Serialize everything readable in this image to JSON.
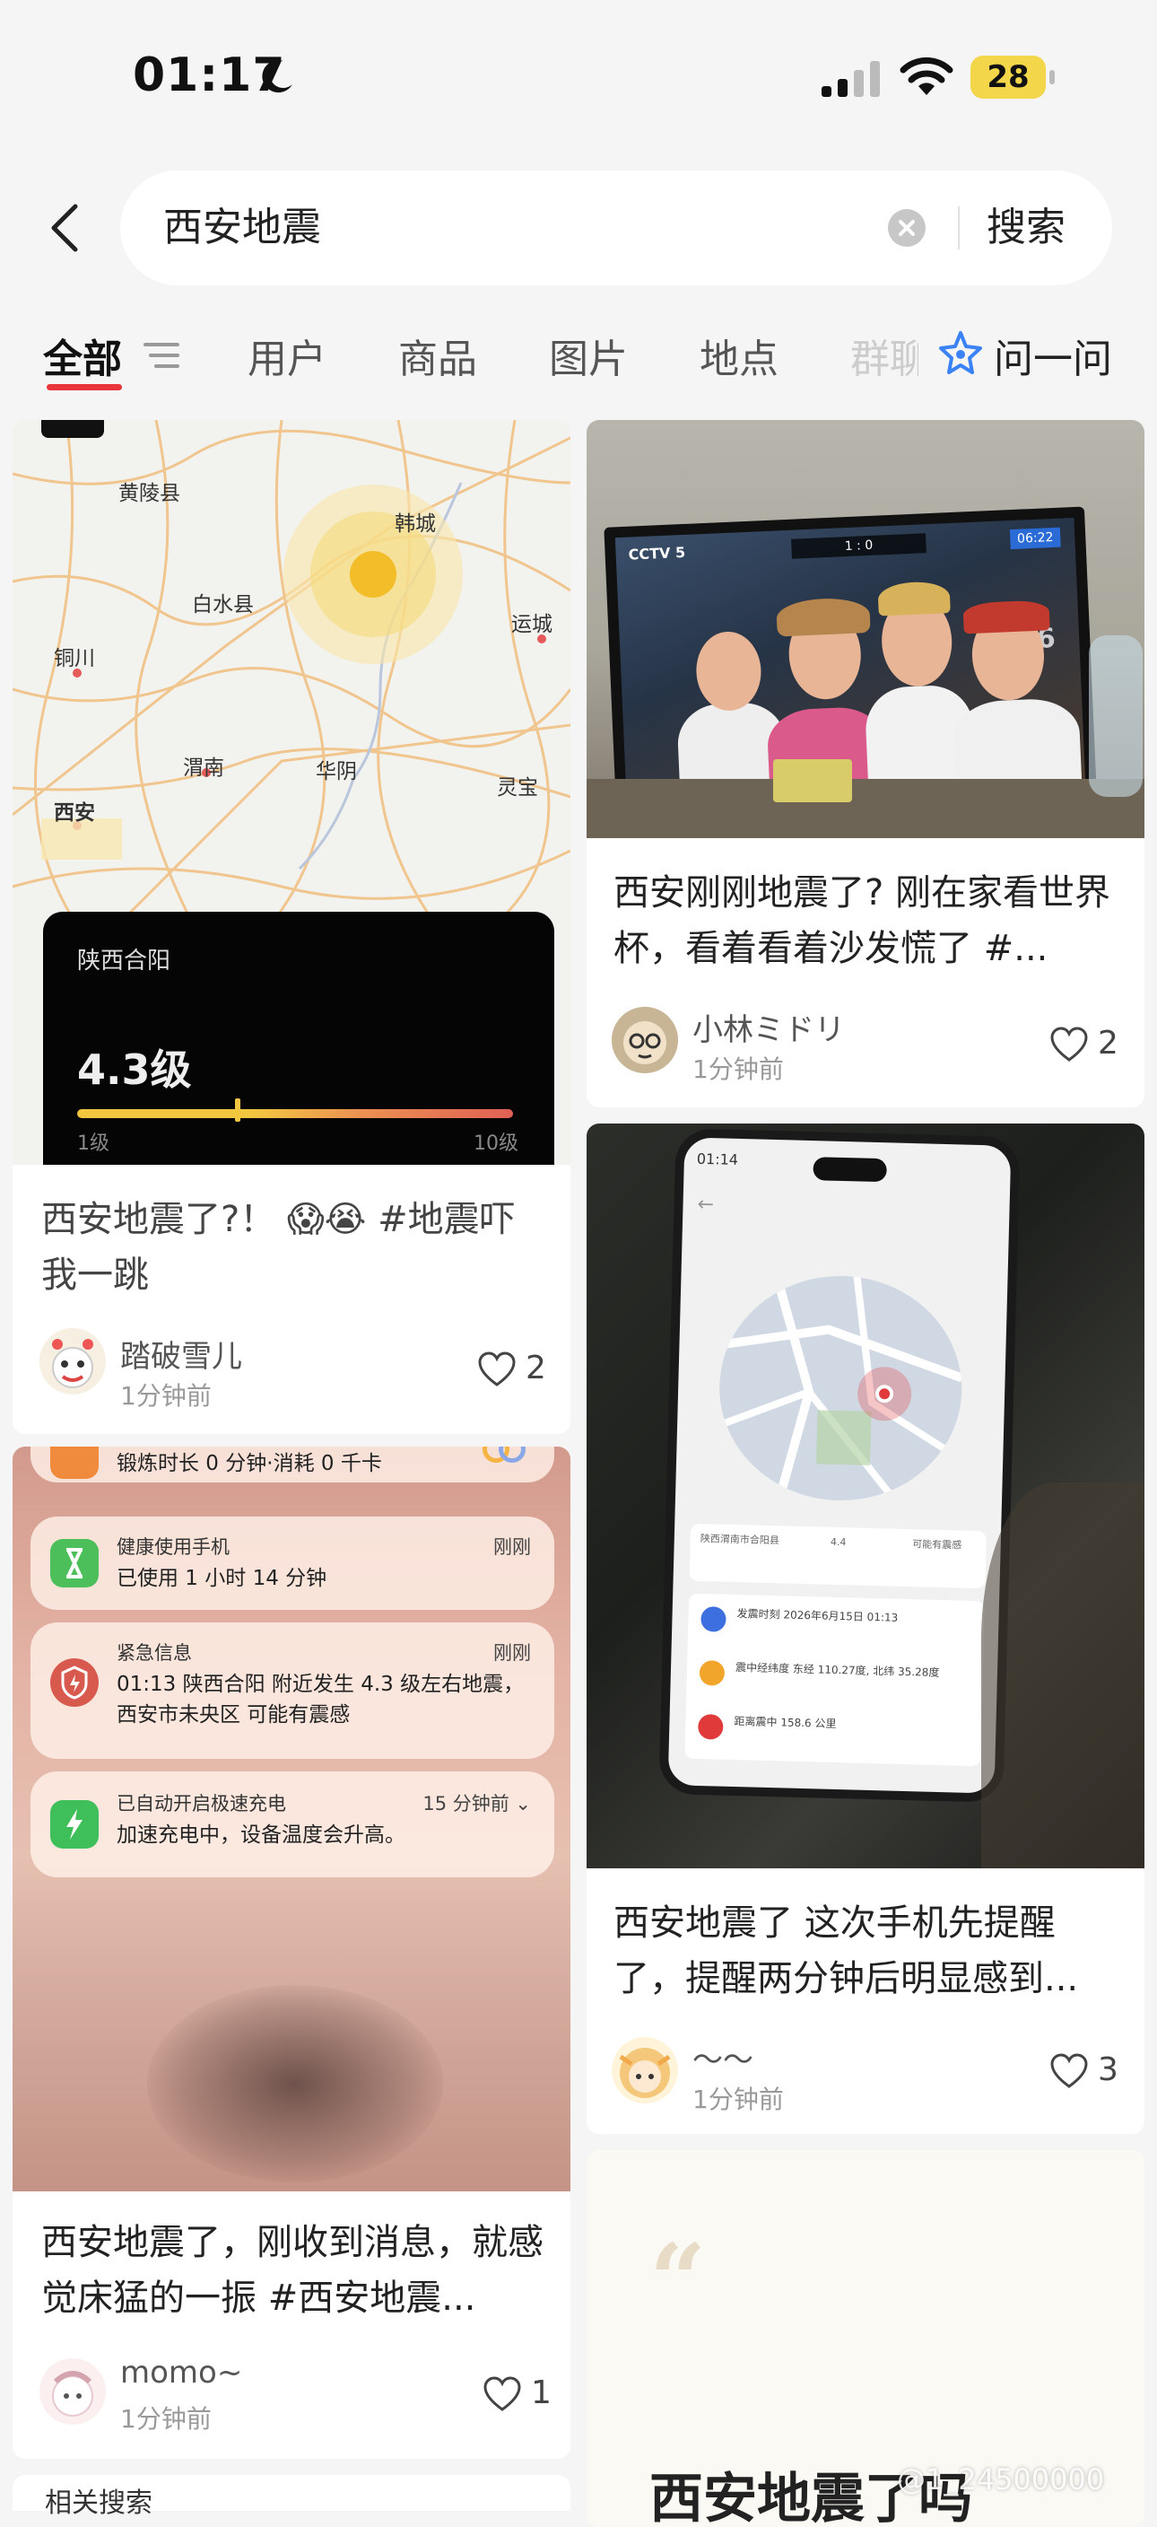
{
  "status_bar": {
    "time": "01:17",
    "battery": "28"
  },
  "search": {
    "query": "西安地震",
    "button": "搜索"
  },
  "tabs": {
    "all": "全部",
    "users": "用户",
    "goods": "商品",
    "images": "图片",
    "places": "地点",
    "groups": "群聊",
    "ask": "问一问"
  },
  "colors": {
    "accent": "#e8343a",
    "ask_icon": "#3b82f6"
  },
  "cards": [
    {
      "title": "西安地震了?！ 😱😭 #地震吓我一跳",
      "user": "踏破雪儿",
      "time": "1分钟前",
      "likes": "2",
      "image": {
        "map_labels": [
          "黄陵县",
          "韩城",
          "白水县",
          "铜川",
          "运城",
          "渭南",
          "华阴",
          "西安",
          "灵宝"
        ],
        "location": "陕西合阳",
        "magnitude": "4.3级",
        "scale_min": "1级",
        "scale_max": "10级"
      }
    },
    {
      "title": "西安刚刚地震了? 刚在家看世界杯，看着看着沙发慌了 #...",
      "user": "小林ミドリ",
      "time": "1分钟前",
      "likes": "2",
      "image": {
        "channel": "CCTV 5",
        "score": "1 : 0",
        "clock": "06:22",
        "tag": "2026"
      }
    },
    {
      "title": "西安地震了 这次手机先提醒了，提醒两分钟后明显感到...",
      "user": "～～",
      "time": "1分钟前",
      "likes": "3",
      "image": {
        "status_time": "01:14",
        "info": [
          "陕西渭南市合阳县",
          "4.4",
          "可能有震感"
        ],
        "rows": [
          "发震时刻 2026年6月15日 01:13",
          "震中经纬度 东经 110.27度, 北纬 35.28度",
          "距离震中 158.6 公里"
        ]
      }
    },
    {
      "title": "西安地震了，刚收到消息，就感觉床猛的一振 #西安地震...",
      "user": "momo~",
      "time": "1分钟前",
      "likes": "1",
      "image": {
        "top_line": "锻炼时长 0 分钟·消耗 0 千卡",
        "notifications": [
          {
            "title": "健康使用手机",
            "time": "刚刚",
            "body": "已使用 1 小时 14 分钟"
          },
          {
            "title": "紧急信息",
            "time": "刚刚",
            "body": "01:13 陕西合阳 附近发生 4.3 级左右地震，西安市未央区 可能有震感"
          },
          {
            "title": "已自动开启极速充电",
            "time": "15 分钟前 ⌄",
            "body": "加速充电中，设备温度会升高。"
          }
        ]
      }
    },
    {
      "title": "西安地震了吗",
      "quote": "“"
    }
  ],
  "watermark": "@1_24500000",
  "related": "相关搜索"
}
